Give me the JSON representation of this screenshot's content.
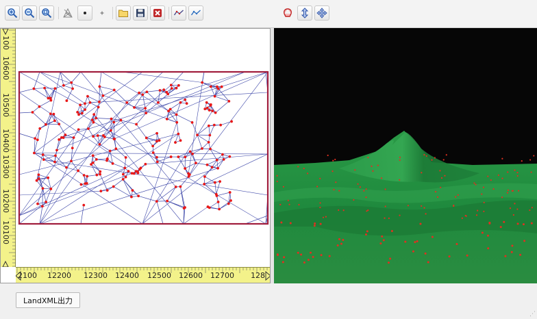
{
  "toolbar": {
    "buttons": [
      {
        "name": "zoom-in-button",
        "icon": "zoom-in-icon"
      },
      {
        "name": "zoom-out-button",
        "icon": "zoom-out-icon"
      },
      {
        "name": "zoom-fit-button",
        "icon": "zoom-fit-icon"
      },
      {
        "name": "tin-tool-button",
        "icon": "tin-icon"
      },
      {
        "name": "point-large-button",
        "icon": "dot-icon"
      },
      {
        "name": "point-small-button",
        "icon": "plus-icon"
      },
      {
        "name": "open-button",
        "icon": "folder-icon"
      },
      {
        "name": "save-button",
        "icon": "floppy-icon"
      },
      {
        "name": "delete-button",
        "icon": "delete-x-icon"
      },
      {
        "name": "polyline-button",
        "icon": "line-chart-red-icon"
      },
      {
        "name": "polyline-alt-button",
        "icon": "line-chart-blue-icon"
      },
      {
        "name": "rotate-button",
        "icon": "rotate-icon"
      },
      {
        "name": "vertical-move-button",
        "icon": "updown-arrow-icon"
      },
      {
        "name": "pan-button",
        "icon": "cross-arrow-icon"
      }
    ]
  },
  "plan_view": {
    "y_ruler_labels": [
      "10100",
      "10200",
      "10300",
      "10400",
      "10500",
      "10600",
      "100"
    ],
    "x_ruler_labels": [
      "2100",
      "12200",
      "12300",
      "12400",
      "12500",
      "12600",
      "12700",
      "128"
    ],
    "colors": {
      "boundary": "#a01c3c",
      "edges": "#3c46a8",
      "points": "#e81818",
      "ruler": "#f3f28a"
    }
  },
  "view3d": {
    "colors": {
      "sky": "#060606",
      "terrain": "#1f8a3e",
      "points": "#e03020"
    }
  },
  "bottom": {
    "export_button_label": "LandXML出力"
  }
}
